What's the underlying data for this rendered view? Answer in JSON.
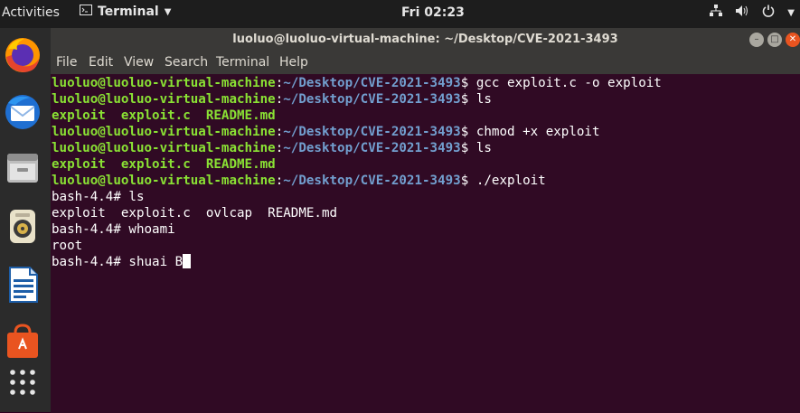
{
  "topbar": {
    "activities": "Activities",
    "app_name": "Terminal",
    "clock": "Fri 02:23"
  },
  "dock": {
    "items": [
      "firefox",
      "thunderbird",
      "files",
      "rhythmbox",
      "libreoffice-writer",
      "software-center",
      "show-applications"
    ]
  },
  "window": {
    "title": "luoluo@luoluo-virtual-machine: ~/Desktop/CVE-2021-3493",
    "menu": [
      "File",
      "Edit",
      "View",
      "Search",
      "Terminal",
      "Help"
    ]
  },
  "terminal": {
    "user_host": "luoluo@luoluo-virtual-machine",
    "cwd": "~/Desktop/CVE-2021-3493",
    "lines": [
      {
        "type": "prompt",
        "cmd": "gcc exploit.c -o exploit"
      },
      {
        "type": "prompt",
        "cmd": "ls"
      },
      {
        "type": "output-green",
        "text": "exploit  exploit.c  README.md"
      },
      {
        "type": "prompt",
        "cmd": "chmod +x exploit"
      },
      {
        "type": "prompt",
        "cmd": "ls"
      },
      {
        "type": "output-green",
        "text": "exploit  exploit.c  README.md"
      },
      {
        "type": "prompt",
        "cmd": "./exploit"
      },
      {
        "type": "plain",
        "text": "bash-4.4# ls"
      },
      {
        "type": "plain",
        "text": "exploit  exploit.c  ovlcap  README.md"
      },
      {
        "type": "plain",
        "text": "bash-4.4# whoami"
      },
      {
        "type": "plain",
        "text": "root"
      },
      {
        "type": "plain",
        "text": "bash-4.4# shuai B",
        "cursor": true
      }
    ]
  },
  "colors": {
    "terminal_bg": "#300a24",
    "prompt_user": "#8ae234",
    "prompt_path": "#729fcf",
    "close_button": "#e95420"
  }
}
